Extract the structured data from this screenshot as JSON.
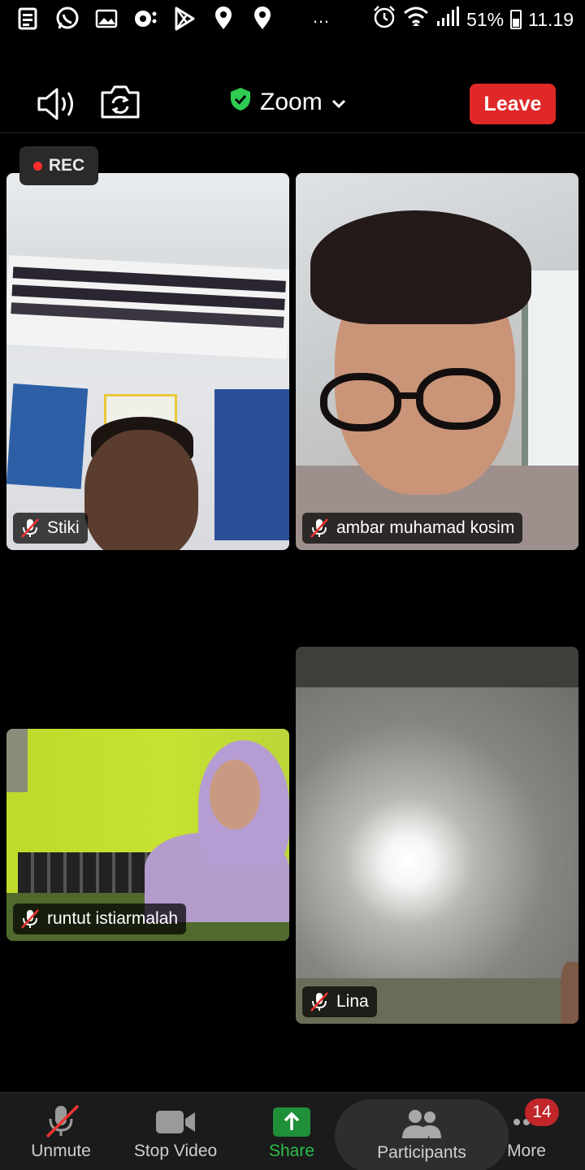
{
  "status_bar": {
    "battery": "51%",
    "time": "11.19",
    "overflow": "…",
    "notification_icons": [
      "notes-icon",
      "whatsapp-icon",
      "gallery-icon",
      "assistant-icon",
      "play-store-icon",
      "location-icon",
      "location-icon"
    ],
    "right_icons": [
      "alarm-icon",
      "wifi-icon",
      "signal-icon"
    ]
  },
  "topbar": {
    "title": "Zoom",
    "leave_label": "Leave",
    "shield_color": "#2ecc51",
    "leave_color": "#e02828"
  },
  "rec_badge": {
    "label": "REC"
  },
  "participants": [
    {
      "name": "Stiki",
      "muted": true
    },
    {
      "name": "ambar muhamad kosim",
      "muted": true
    },
    {
      "name": "runtut istiarmalah",
      "muted": true
    },
    {
      "name": "Lina",
      "muted": true
    }
  ],
  "toolbar": {
    "unmute": "Unmute",
    "stop_video": "Stop Video",
    "share": "Share",
    "participants": "Participants",
    "more": "More",
    "badge_count": "14",
    "share_color": "#2bbf4c"
  }
}
